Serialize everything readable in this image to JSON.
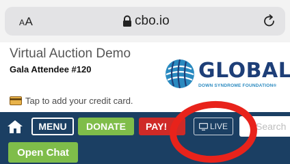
{
  "browser": {
    "text_size_label_small": "A",
    "text_size_label_large": "A",
    "url": "cbo.io",
    "icons": {
      "lock": "lock-icon",
      "reload": "reload-icon"
    }
  },
  "header": {
    "title": "Virtual Auction Demo",
    "attendee": "Gala Attendee #120",
    "logo": {
      "word": "GLOBAL",
      "subtitle": "DOWN SYNDROME FOUNDATION®"
    },
    "credit_card_prompt": "Tap to add your credit card."
  },
  "nav": {
    "menu_label": "MENU",
    "donate_label": "DONATE",
    "pay_label": "PAY!",
    "live_label": "LIVE",
    "search_placeholder": "Search",
    "open_chat_label": "Open Chat",
    "icons": {
      "home": "home-icon",
      "live": "monitor-icon",
      "card": "credit-card-icon"
    }
  },
  "colors": {
    "navbar": "#1b3f63",
    "donate": "#7fbd4a",
    "pay": "#cf2a27",
    "logo_blue": "#1e3f78",
    "annotation_red": "#e8231b"
  }
}
